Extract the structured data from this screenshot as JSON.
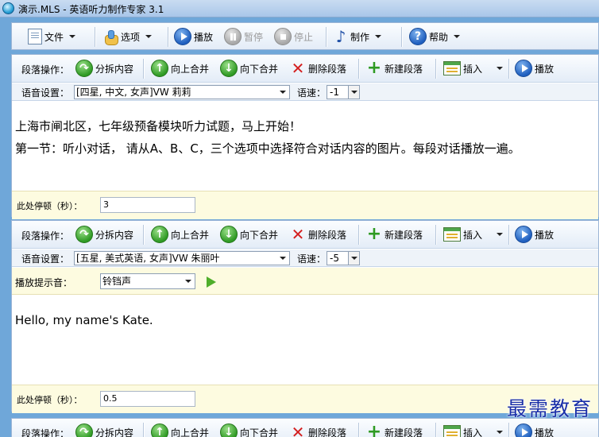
{
  "window": {
    "title": "演示.MLS - 英语听力制作专家 3.1"
  },
  "menubar": {
    "file": "文件",
    "options": "选项",
    "play": "播放",
    "pause": "暂停",
    "stop": "停止",
    "make": "制作",
    "help": "帮助"
  },
  "ops": {
    "label": "段落操作：",
    "split": "分拆内容",
    "merge_up": "向上合并",
    "merge_down": "向下合并",
    "delete": "删除段落",
    "new": "新建段落",
    "insert": "插入",
    "play": "播放"
  },
  "voice_label": "语音设置：",
  "speed_label": "语速：",
  "pause_label": "此处停顿（秒）：",
  "tone_label": "播放提示音：",
  "paragraphs": [
    {
      "voice": "[四星, 中文, 女声]VW 莉莉",
      "speed": "-1",
      "lines": [
        "上海市闸北区，七年级预备模块听力试题，马上开始！",
        "第一节：听小对话， 请从A、B、C，三个选项中选择符合对话内容的图片。每段对话播放一遍。"
      ],
      "pause": "3"
    },
    {
      "voice": "[五星, 美式英语, 女声]VW 朱丽叶",
      "speed": "-5",
      "tone": "铃铛声",
      "lines": [
        "Hello, my name's Kate."
      ],
      "pause": "0.5"
    }
  ],
  "watermark": "最需教育"
}
